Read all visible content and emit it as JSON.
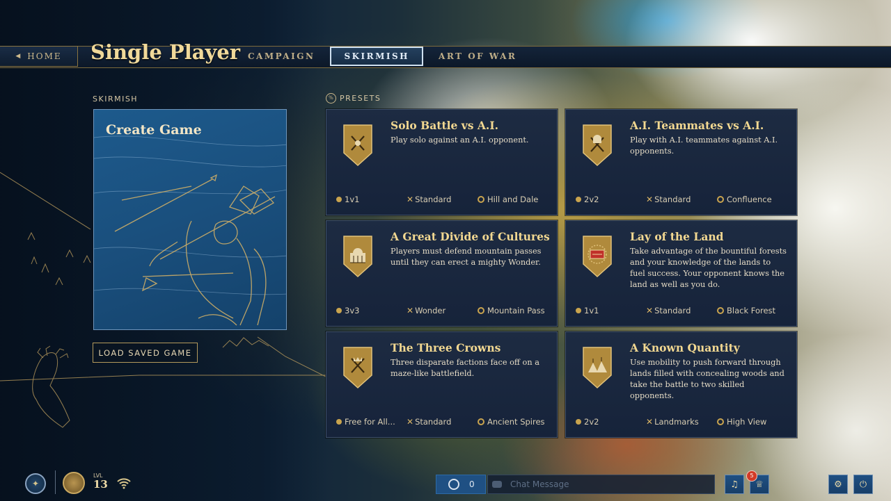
{
  "nav": {
    "home_label": "HOME",
    "title": "Single Player",
    "tabs": [
      {
        "label": "CAMPAIGN",
        "active": false
      },
      {
        "label": "SKIRMISH",
        "active": true
      },
      {
        "label": "ART OF WAR",
        "active": false
      }
    ]
  },
  "skirmish": {
    "section_label": "SKIRMISH",
    "create_game": "Create Game",
    "load_saved_game": "LOAD SAVED GAME"
  },
  "presets": {
    "section_label": "PRESETS",
    "cards": [
      {
        "title": "Solo Battle vs A.I.",
        "description": "Play solo against an A.I. opponent.",
        "teams": "1v1",
        "mode": "Standard",
        "map": "Hill and Dale",
        "icon": "axes-banner-icon"
      },
      {
        "title": "A.I. Teammates vs A.I.",
        "description": "Play with A.I. teammates against A.I. opponents.",
        "teams": "2v2",
        "mode": "Standard",
        "map": "Confluence",
        "icon": "helmet-axes-banner-icon"
      },
      {
        "title": "A Great Divide of Cultures",
        "description": "Players must defend mountain passes until they can erect a mighty Wonder.",
        "teams": "3v3",
        "mode": "Wonder",
        "map": "Mountain Pass",
        "icon": "wonder-banner-icon"
      },
      {
        "title": "Lay of the Land",
        "description": "Take advantage of the bountiful forests and your knowledge of the lands to fuel success. Your opponent knows the land as well as you do.",
        "teams": "1v1",
        "mode": "Standard",
        "map": "Black Forest",
        "icon": "map-banner-icon"
      },
      {
        "title": "The Three Crowns",
        "description": "Three disparate factions face off on a maze-like battlefield.",
        "teams": "Free for All...",
        "mode": "Standard",
        "map": "Ancient Spires",
        "icon": "crowns-banner-icon"
      },
      {
        "title": "A Known Quantity",
        "description": "Use mobility to push forward through lands filled with concealing woods and take the battle to two skilled opponents.",
        "teams": "2v2",
        "mode": "Landmarks",
        "map": "High View",
        "icon": "tents-banner-icon"
      }
    ]
  },
  "bottom": {
    "level_label": "LVL",
    "level_value": "13",
    "friends_count": "0",
    "chat_placeholder": "Chat Message",
    "notification_count": "5"
  },
  "colors": {
    "accent_gold": "#f2d891",
    "card_bg": "#1a2740",
    "active_tab_border": "#cfe0f0",
    "create_card_blue": "#1a5282"
  }
}
